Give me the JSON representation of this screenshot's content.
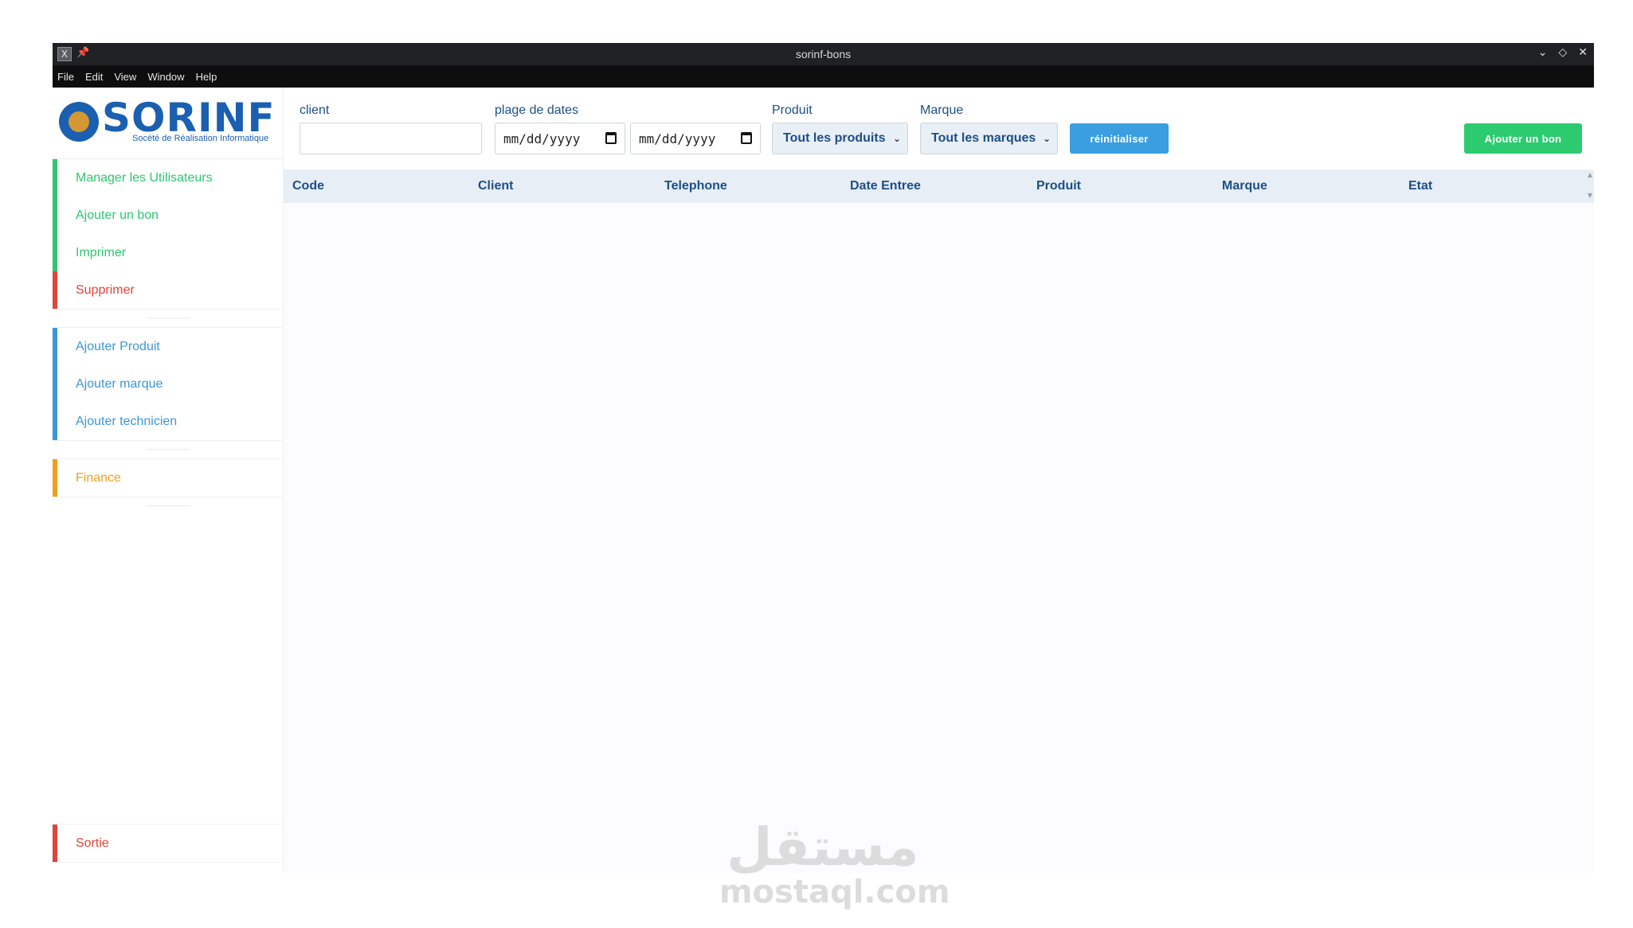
{
  "window": {
    "title": "sorinf-bons",
    "menu": [
      "File",
      "Edit",
      "View",
      "Window",
      "Help"
    ]
  },
  "logo": {
    "brand": "SORINF",
    "tagline": "Socété de Réalisation Informatique"
  },
  "sidebar": {
    "group1": [
      {
        "label": "Manager les Utilisateurs",
        "color": "#2ec66f"
      },
      {
        "label": "Ajouter un bon",
        "color": "#2ec66f"
      },
      {
        "label": "Imprimer",
        "color": "#2ec66f"
      },
      {
        "label": "Supprimer",
        "color": "#e0453b"
      }
    ],
    "group2": [
      {
        "label": "Ajouter Produit",
        "color": "#3b97d8"
      },
      {
        "label": "Ajouter marque",
        "color": "#3b97d8"
      },
      {
        "label": "Ajouter technicien",
        "color": "#3b97d8"
      }
    ],
    "group3": [
      {
        "label": "Finance",
        "color": "#f0a11b"
      }
    ],
    "exit": {
      "label": "Sortie",
      "color": "#e0453b"
    }
  },
  "filters": {
    "client_label": "client",
    "client_value": "",
    "dates_label": "plage de dates",
    "date_from": "mm/dd/yyyy",
    "date_to": "mm/dd/yyyy",
    "produit_label": "Produit",
    "produit_selected": "Tout les produits",
    "marque_label": "Marque",
    "marque_selected": "Tout les marques",
    "reset_label": "réinitialiser",
    "add_label": "Ajouter un bon"
  },
  "table": {
    "columns": [
      "Code",
      "Client",
      "Telephone",
      "Date Entree",
      "Produit",
      "Marque",
      "Etat"
    ],
    "rows": []
  },
  "watermark": {
    "arabic": "مستقل",
    "latin": "mostaql.com"
  },
  "colors": {
    "accent_green": "#2dcb6f",
    "accent_blue": "#3a9ee0",
    "accent_red": "#e0453b",
    "accent_orange": "#f0a11b",
    "header_text": "#1c4f86"
  }
}
